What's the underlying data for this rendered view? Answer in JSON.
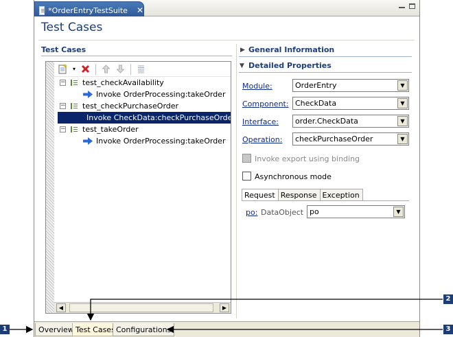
{
  "editor_tab": {
    "title": "*OrderEntryTestSuite",
    "close": "✕"
  },
  "page_title": "Test Cases",
  "test_cases_section": {
    "heading": "Test Cases"
  },
  "tree": {
    "items": [
      {
        "label": "test_checkAvailability",
        "kind": "suite",
        "expander": "−"
      },
      {
        "label": "Invoke OrderProcessing:takeOrder",
        "kind": "invoke"
      },
      {
        "label": "test_checkPurchaseOrder",
        "kind": "suite",
        "expander": "−"
      },
      {
        "label": "Invoke CheckData:checkPurchaseOrder",
        "kind": "invoke",
        "selected": true
      },
      {
        "label": "test_takeOrder",
        "kind": "suite",
        "expander": "−"
      },
      {
        "label": "Invoke OrderProcessing:takeOrder",
        "kind": "invoke"
      }
    ]
  },
  "general_info": {
    "heading": "General Information"
  },
  "detailed_props": {
    "heading": "Detailed Properties",
    "fields": [
      {
        "label": "Module:",
        "value": "OrderEntry"
      },
      {
        "label": "Component:",
        "value": "CheckData"
      },
      {
        "label": "Interface:",
        "value": "order.CheckData"
      },
      {
        "label": "Operation:",
        "value": "checkPurchaseOrder"
      }
    ],
    "invoke_export": "Invoke export using binding",
    "async_mode": "Asynchronous mode",
    "tabs": [
      "Request",
      "Response",
      "Exception"
    ],
    "param": {
      "name": "po:",
      "type": "DataObject",
      "value": "po"
    }
  },
  "bottom_tabs": [
    "Overview",
    "Test Cases",
    "Configurations"
  ],
  "callouts": [
    "1",
    "2",
    "3"
  ],
  "colors": {
    "accent": "#1c3d78",
    "selection": "#0a246a",
    "tab": "#2f5a9a"
  }
}
